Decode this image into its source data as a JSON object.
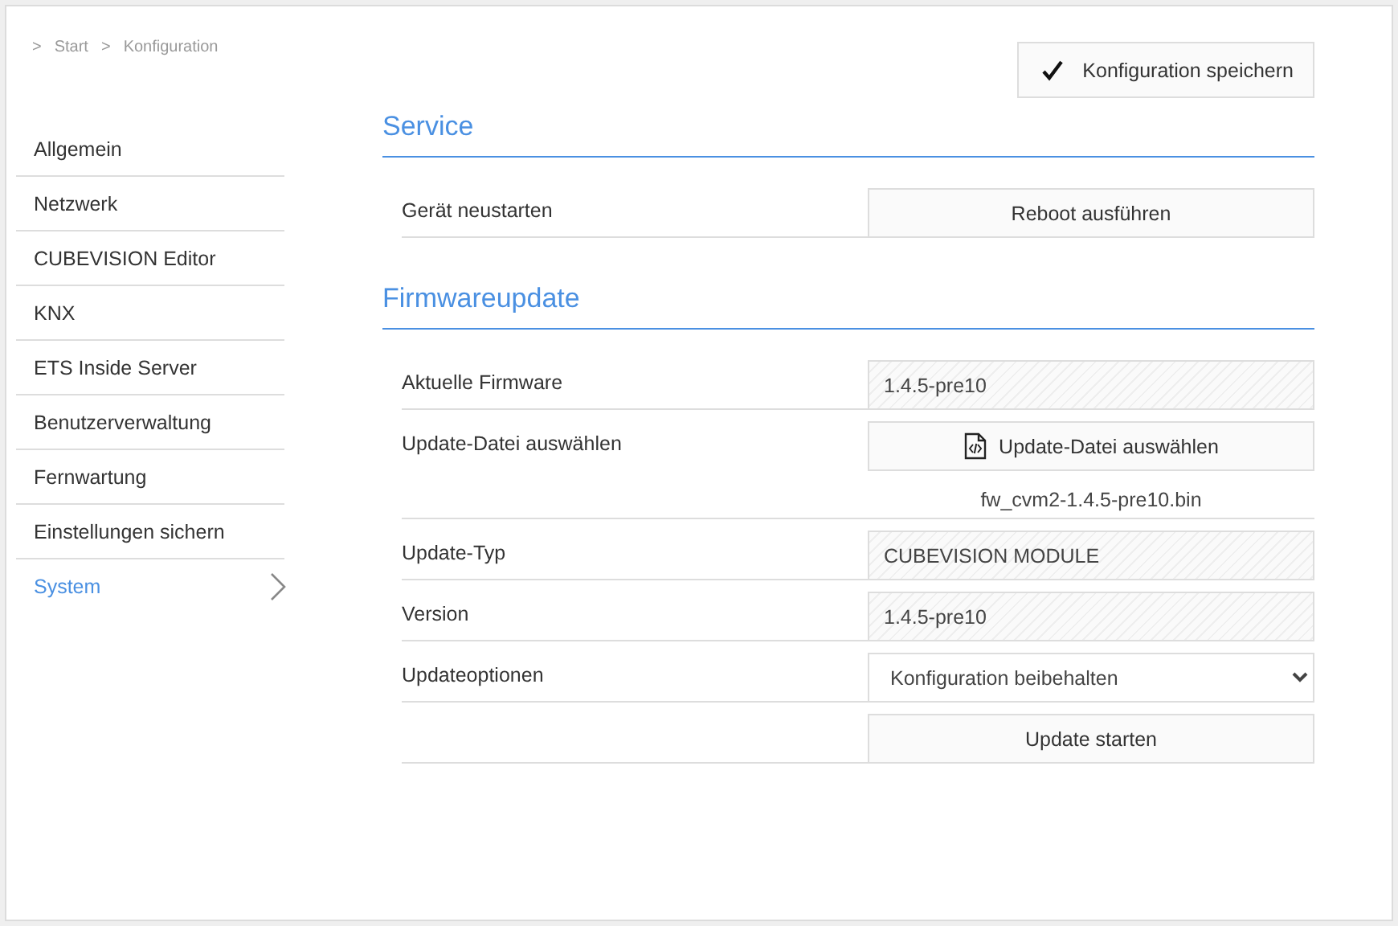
{
  "breadcrumb": [
    {
      "separator": ">",
      "label": "Start"
    },
    {
      "separator": ">",
      "label": "Konfiguration"
    }
  ],
  "sidebar": {
    "items": [
      {
        "label": "Allgemein",
        "selected": false
      },
      {
        "label": "Netzwerk",
        "selected": false
      },
      {
        "label": "CUBEVISION Editor",
        "selected": false
      },
      {
        "label": "KNX",
        "selected": false
      },
      {
        "label": "ETS Inside Server",
        "selected": false
      },
      {
        "label": "Benutzerverwaltung",
        "selected": false
      },
      {
        "label": "Fernwartung",
        "selected": false
      },
      {
        "label": "Einstellungen sichern",
        "selected": false
      },
      {
        "label": "System",
        "selected": true
      }
    ]
  },
  "save_button": {
    "label": "Konfiguration speichern"
  },
  "sections": [
    {
      "title": "Service",
      "rows": [
        {
          "kind": "button",
          "label": "Gerät neustarten",
          "button": "Reboot ausführen"
        }
      ]
    },
    {
      "title": "Firmwareupdate",
      "rows": [
        {
          "kind": "readonly",
          "label": "Aktuelle Firmware",
          "value": "1.4.5-pre10"
        },
        {
          "kind": "file",
          "label": "Update-Datei auswählen",
          "button": "Update-Datei auswählen",
          "filename": "fw_cvm2-1.4.5-pre10.bin"
        },
        {
          "kind": "readonly",
          "label": "Update-Typ",
          "value": "CUBEVISION MODULE"
        },
        {
          "kind": "readonly",
          "label": "Version",
          "value": "1.4.5-pre10"
        },
        {
          "kind": "select",
          "label": "Updateoptionen",
          "value": "Konfiguration beibehalten"
        },
        {
          "kind": "button",
          "button": "Update starten"
        }
      ]
    }
  ]
}
